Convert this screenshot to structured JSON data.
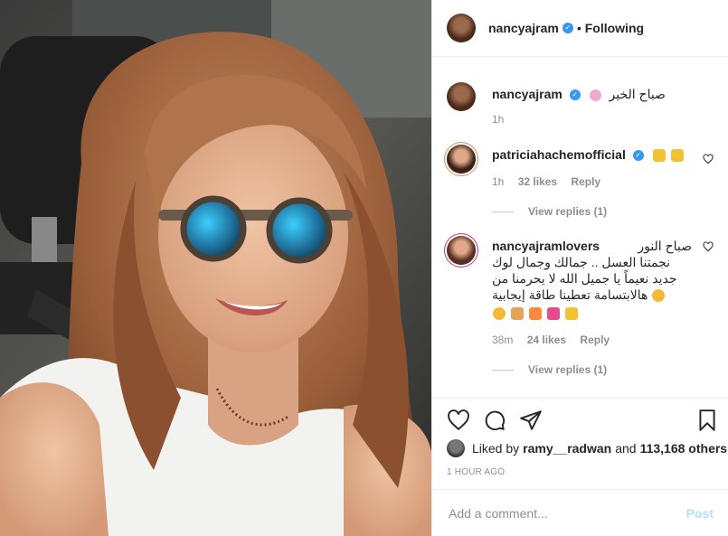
{
  "post": {
    "author": "nancyajram",
    "follow_status": "Following",
    "separator": "•",
    "caption": {
      "text": "صباح الخير",
      "time": "1h"
    }
  },
  "comments": [
    {
      "username": "patriciahachemofficial",
      "text": "",
      "time": "1h",
      "likes": "32 likes",
      "reply": "Reply",
      "view_replies": "View replies (1)"
    },
    {
      "username": "nancyajramlovers",
      "lines": [
        "صباح النور",
        "نجمتنا العسل .. جمالك وجمال لوك",
        "جديد نعيماً يا جميل الله لا يحرمنا من",
        "هالابتسامة تعطينا طاقة إيجابية"
      ],
      "time": "38m",
      "likes": "24 likes",
      "reply": "Reply",
      "view_replies": "View replies (1)"
    }
  ],
  "likes": {
    "prefix": "Liked by",
    "user": "ramy__radwan",
    "and": "and",
    "count": "113,168 others"
  },
  "timestamp": "1 HOUR AGO",
  "add_comment": {
    "placeholder": "Add a comment...",
    "post_label": "Post"
  },
  "colors": {
    "verified": "#3897f0",
    "post_disabled": "#b2dffc",
    "muted": "#8e8e8e"
  }
}
